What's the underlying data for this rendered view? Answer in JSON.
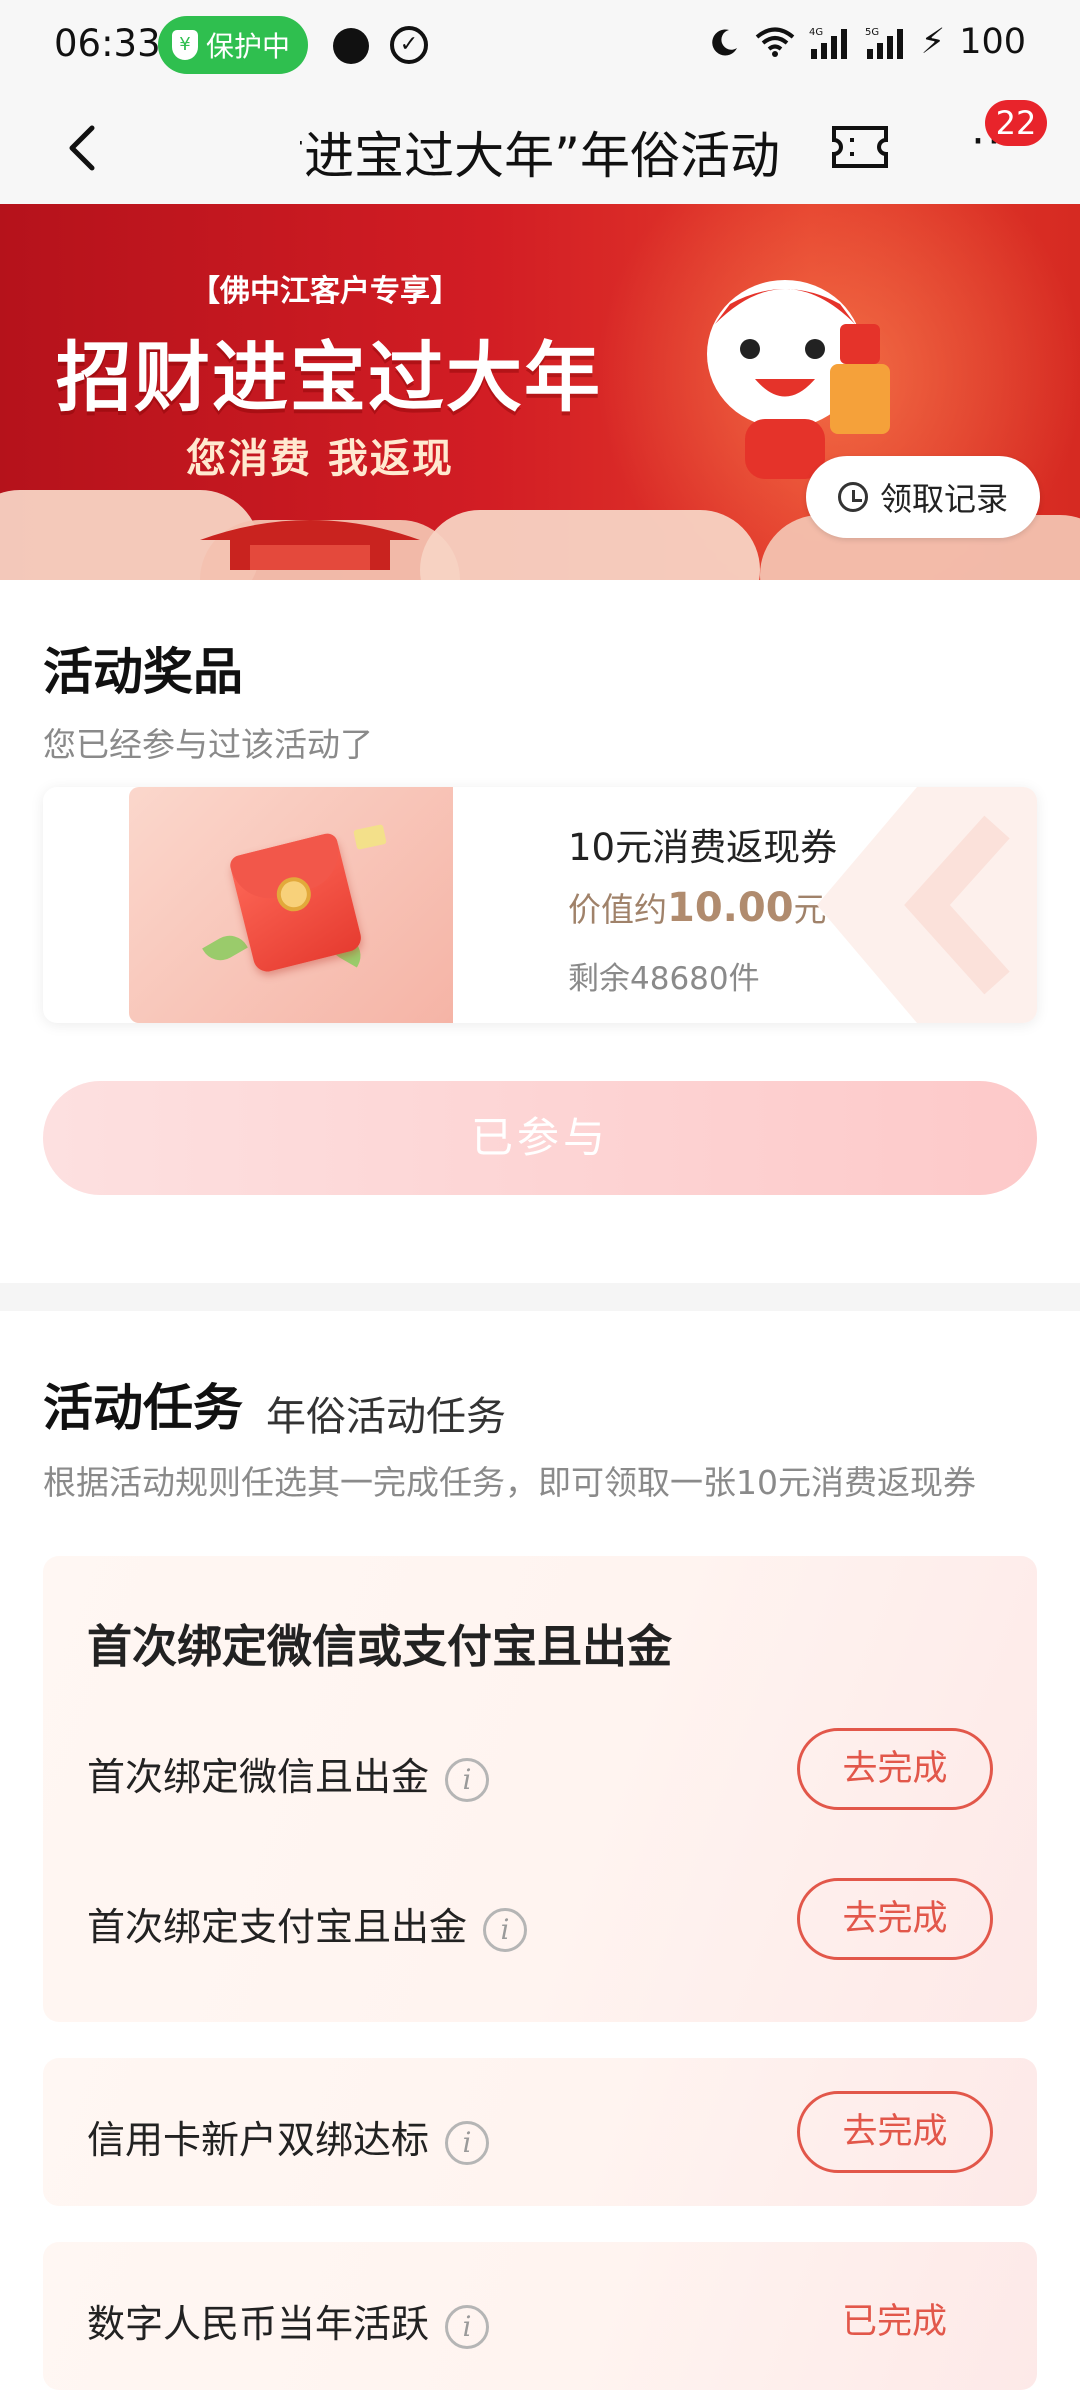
{
  "status_bar": {
    "time": "06:33",
    "protect_label": "保护中",
    "battery": "100",
    "network_4g": "4G",
    "network_5g": "5G"
  },
  "header": {
    "title": "招财进宝过大年”年俗活动",
    "notification_count": "22"
  },
  "banner": {
    "tag": "【佛中江客户专享】",
    "headline": "招财进宝过大年",
    "subline": "您消费 我返现",
    "record_button": "领取记录"
  },
  "prize_section": {
    "title": "活动奖品",
    "note": "您已经参与过该活动了",
    "prize": {
      "name": "10元消费返现券",
      "value_prefix": "价值约",
      "value_amount": "10.00",
      "value_unit": "元",
      "remaining": "剩余48680件"
    },
    "joined_button": "已参与"
  },
  "task_section": {
    "title": "活动任务",
    "subtitle": "年俗活动任务",
    "description": "根据活动规则任选其一完成任务，即可领取一张10元消费返现券",
    "group": {
      "title": "首次绑定微信或支付宝且出金",
      "tasks": [
        {
          "label": "首次绑定微信且出金",
          "action": "去完成"
        },
        {
          "label": "首次绑定支付宝且出金",
          "action": "去完成"
        }
      ]
    },
    "credit_task": {
      "label": "信用卡新户双绑达标",
      "action": "去完成"
    },
    "digital_task": {
      "label": "数字人民币当年活跃",
      "status": "已完成"
    }
  },
  "colors": {
    "brand_red": "#d21d24",
    "action_red": "#e2574a",
    "status_green": "#2fbf4f"
  }
}
